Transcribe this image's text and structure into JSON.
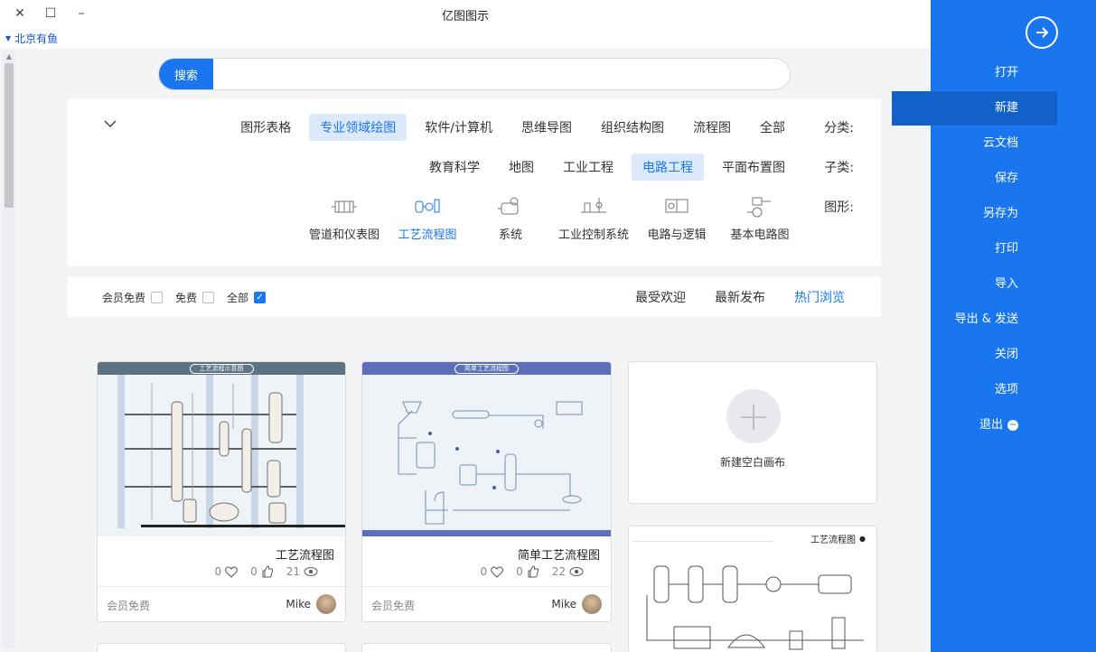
{
  "window": {
    "title": "亿图图示",
    "lang": "北京有鱼",
    "close": "✕",
    "maximize": "☐",
    "minimize": "–"
  },
  "search": {
    "button": "搜索",
    "placeholder": "",
    "value": ""
  },
  "categories": {
    "label": "分类:",
    "items": [
      "全部",
      "流程图",
      "组织结构图",
      "思维导图",
      "软件/计算机",
      "专业领域绘图",
      "图形表格"
    ],
    "active": "专业领域绘图"
  },
  "subcategories": {
    "label": "子类:",
    "items": [
      "平面布置图",
      "电路工程",
      "工业工程",
      "地图",
      "教育科学"
    ],
    "active": "电路工程"
  },
  "shapes": {
    "label": "图形:",
    "items": [
      "基本电路图",
      "电路与逻辑",
      "工业控制系统",
      "系统",
      "工艺流程图",
      "管道和仪表图"
    ],
    "active": "工艺流程图"
  },
  "sort": {
    "items": [
      "热门浏览",
      "最新发布",
      "最受欢迎"
    ],
    "active": "热门浏览"
  },
  "filters": {
    "items": [
      "全部",
      "免费",
      "会员免费"
    ],
    "checked": "全部"
  },
  "new_card": {
    "label": "新建空白画布"
  },
  "cards": [
    {
      "title": "简单工艺流程图",
      "thumb_header": "简单工艺流程图",
      "views": "22",
      "likes": "0",
      "favorites": "0",
      "author": "Mike",
      "price": "会员免费",
      "header_color": "#5b6fbb"
    },
    {
      "title": "工艺流程图",
      "thumb_header": "工艺流程示意图",
      "views": "21",
      "likes": "0",
      "favorites": "0",
      "author": "Mike",
      "price": "会员免费",
      "header_color": "#5f7284"
    }
  ],
  "card_partial": {
    "title": "工艺流程图"
  },
  "sidebar": {
    "items": [
      "打开",
      "新建",
      "云文档",
      "保存",
      "另存为",
      "打印",
      "导入",
      "导出 & 发送",
      "关闭",
      "选项",
      "退出"
    ],
    "active": "新建"
  },
  "colors": {
    "accent": "#1976ee",
    "sidebar": "#1976ee",
    "sidebar_active": "#1161c9"
  }
}
